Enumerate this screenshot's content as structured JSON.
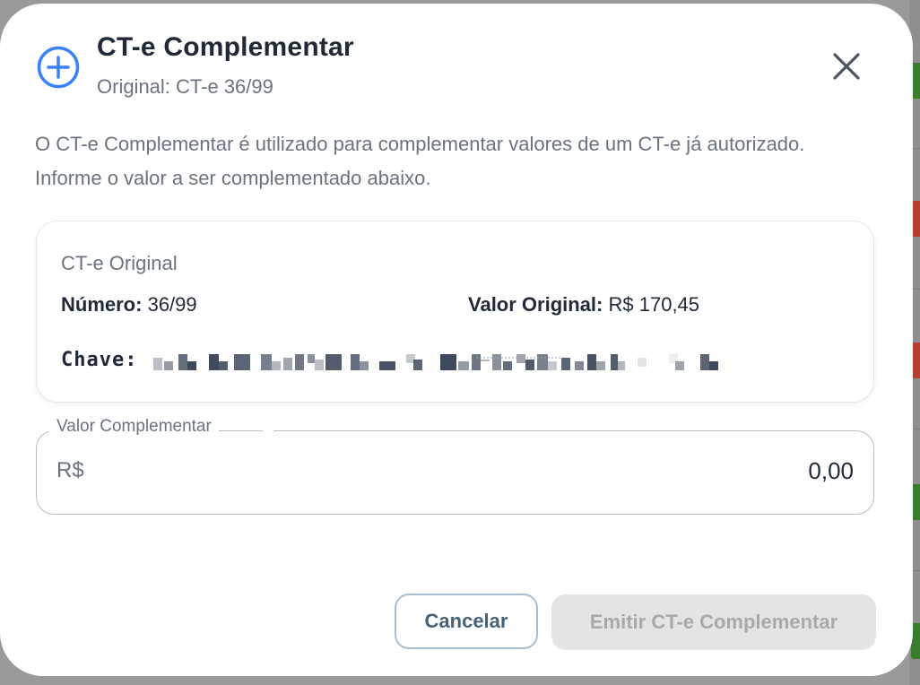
{
  "dialog": {
    "title": "CT-e Complementar",
    "subtitle": "Original: CT-e 36/99",
    "description": "O CT-e Complementar é utilizado para complementar valores de um CT-e já autorizado. Informe o valor a ser complementado abaixo."
  },
  "original_card": {
    "title": "CT-e Original",
    "numero_label": "Número:",
    "numero_value": "36/99",
    "valor_label": "Valor Original:",
    "valor_value": "R$ 170,45",
    "chave_label": "Chave:"
  },
  "complement_field": {
    "label": "Valor Complementar",
    "prefix": "R$",
    "value": "0,00"
  },
  "actions": {
    "cancel_label": "Cancelar",
    "emit_label": "Emitir CT-e Complementar"
  },
  "icons": {
    "header": "plus-circle-icon",
    "close": "close-icon"
  },
  "colors": {
    "accent": "#3b82f6",
    "disabled_bg": "#e4e4e4",
    "cancel_border": "#a9bfd1"
  }
}
